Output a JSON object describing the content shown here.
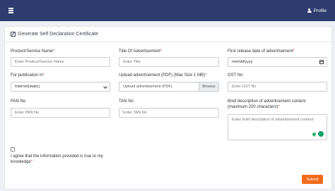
{
  "topbar": {
    "profile_label": "Profile"
  },
  "form": {
    "title": "Generate Self Declaration Certificate",
    "fields": {
      "product": {
        "label": "Product/Service Name",
        "required": "*",
        "placeholder": "Enter Product/Service Name"
      },
      "title": {
        "label": "Title Of Advertisement",
        "required": "*",
        "placeholder": "Enter Title"
      },
      "release_date": {
        "label": "First release date of advertisement",
        "required": "*",
        "value": "mm/dd/yyyy"
      },
      "publication": {
        "label": "For publication in",
        "required": "*",
        "value": "Internet(static)"
      },
      "upload": {
        "label": "Upload advertisement (PDF) (Max Size 1 MB)",
        "required": "*",
        "value": "Upload advertisement (PDF)",
        "browse": "Browse"
      },
      "gst": {
        "label": "GST No",
        "placeholder": "Enter GST No"
      },
      "pan": {
        "label": "PAN No",
        "placeholder": "Enter PAN No"
      },
      "tan": {
        "label": "TAN No",
        "placeholder": "Enter TAN No"
      },
      "description": {
        "label_line1": "Brief description of advertisement content",
        "label_line2": "(maximum 200 characters)",
        "required": "*",
        "placeholder": "Enter brief description of advertisement content"
      }
    },
    "agreement": {
      "line1": "I agree that the information provided is true to my",
      "line2": "knowledge",
      "required": "*"
    },
    "submit_label": "Submit"
  }
}
